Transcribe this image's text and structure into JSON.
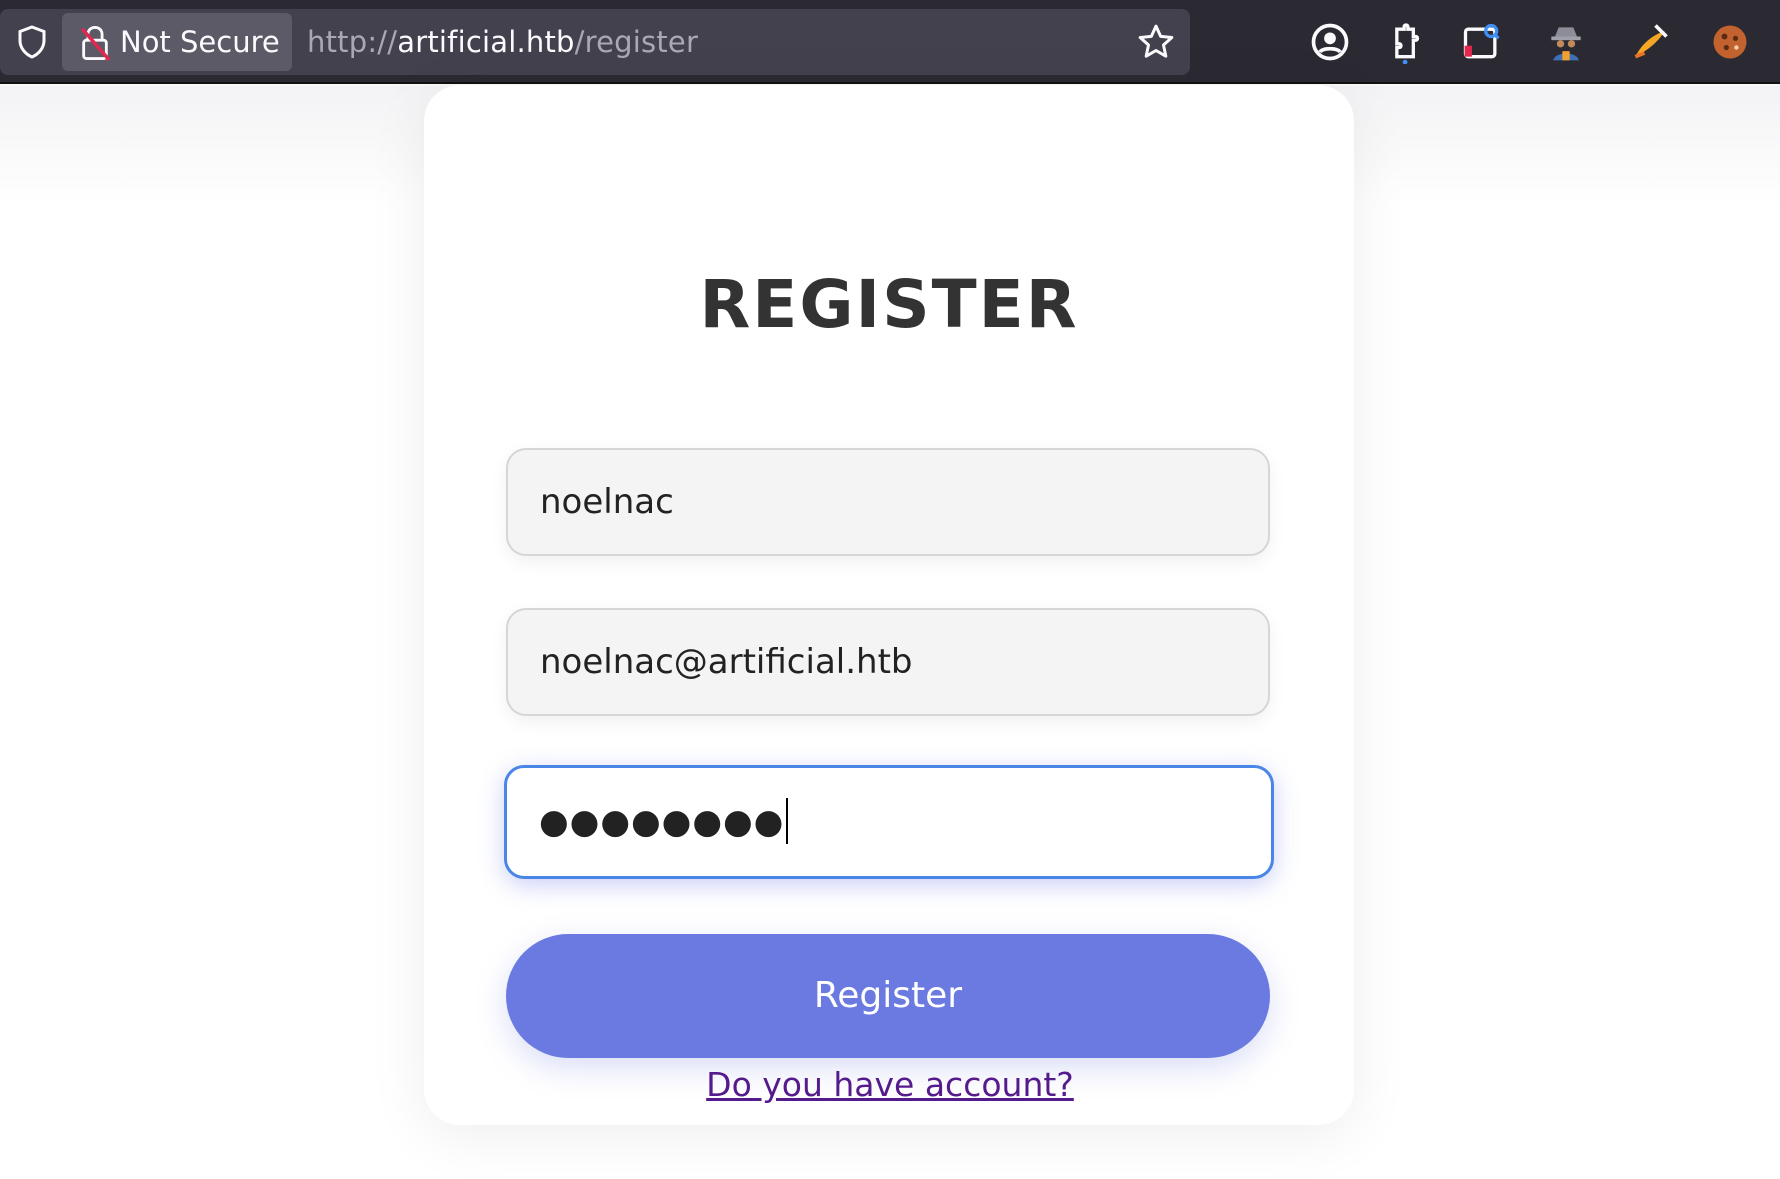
{
  "browser": {
    "security_label": "Not Secure",
    "url_scheme": "http://",
    "url_host": "artificial.htb",
    "url_path": "/register",
    "icons": [
      "shield-icon",
      "insecure-lock-icon",
      "bookmark-star-icon",
      "account-icon",
      "extensions-icon",
      "screenshot-icon",
      "spy-extension-icon",
      "paint-extension-icon",
      "cookie-extension-icon"
    ]
  },
  "form": {
    "title": "REGISTER",
    "username_value": "noelnac",
    "email_value": "noelnac@artificial.htb",
    "password_masked": "●●●●●●●●",
    "submit_label": "Register",
    "login_link": "Do you have account?"
  },
  "colors": {
    "accent": "#6b7ae0",
    "focus_border": "#4a86e8",
    "link": "#551a8b",
    "toolbar": "#2b2a33"
  }
}
